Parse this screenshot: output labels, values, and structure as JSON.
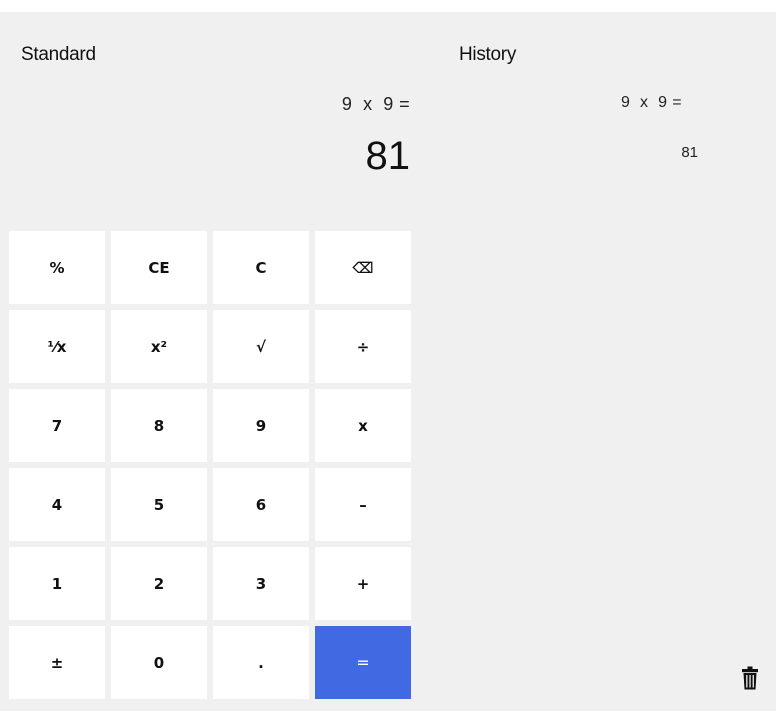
{
  "app": {
    "mode_title": "Standard",
    "history_title": "History"
  },
  "display": {
    "expression": "9  x  9 =",
    "result": "81"
  },
  "history": {
    "items": [
      {
        "expression": "9  x  9 =",
        "result": "81"
      }
    ]
  },
  "keypad": {
    "keys": [
      "%",
      "CE",
      "C",
      "⌫",
      "⅟x",
      "x²",
      "√",
      "÷",
      "7",
      "8",
      "9",
      "x",
      "4",
      "5",
      "6",
      "–",
      "1",
      "2",
      "3",
      "+",
      "±",
      "0",
      ".",
      "="
    ]
  },
  "theme": {
    "background": "#f0f0f0",
    "key_background": "#ffffff",
    "accent": "#4169e1"
  },
  "icons": {
    "clear_history": "trash-icon"
  }
}
